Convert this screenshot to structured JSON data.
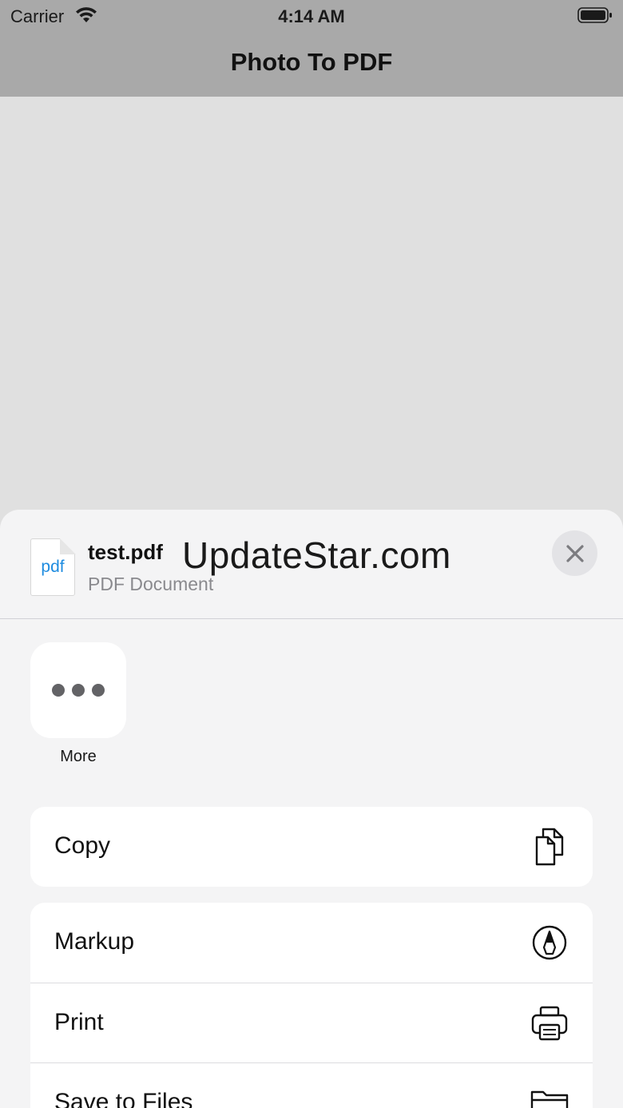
{
  "status_bar": {
    "carrier": "Carrier",
    "time": "4:14 AM",
    "icons": [
      "wifi-icon",
      "battery-icon"
    ]
  },
  "nav": {
    "title": "Photo To PDF"
  },
  "share_sheet": {
    "file": {
      "thumbnail_text": "pdf",
      "name": "test.pdf",
      "type": "PDF Document"
    },
    "watermark": "UpdateStar.com",
    "close_icon": "close-icon",
    "apps": [
      {
        "label": "More",
        "icon": "more-dots-icon"
      }
    ],
    "copy_action": {
      "label": "Copy",
      "icon": "copy-icon"
    },
    "actions": [
      {
        "label": "Markup",
        "icon": "markup-icon"
      },
      {
        "label": "Print",
        "icon": "print-icon"
      },
      {
        "label": "Save to Files",
        "icon": "folder-icon"
      }
    ]
  },
  "colors": {
    "thumbnail_text": "#1e8ce0",
    "sheet_background": "#f4f4f5",
    "dimmed_background": "#a9a9a9"
  }
}
